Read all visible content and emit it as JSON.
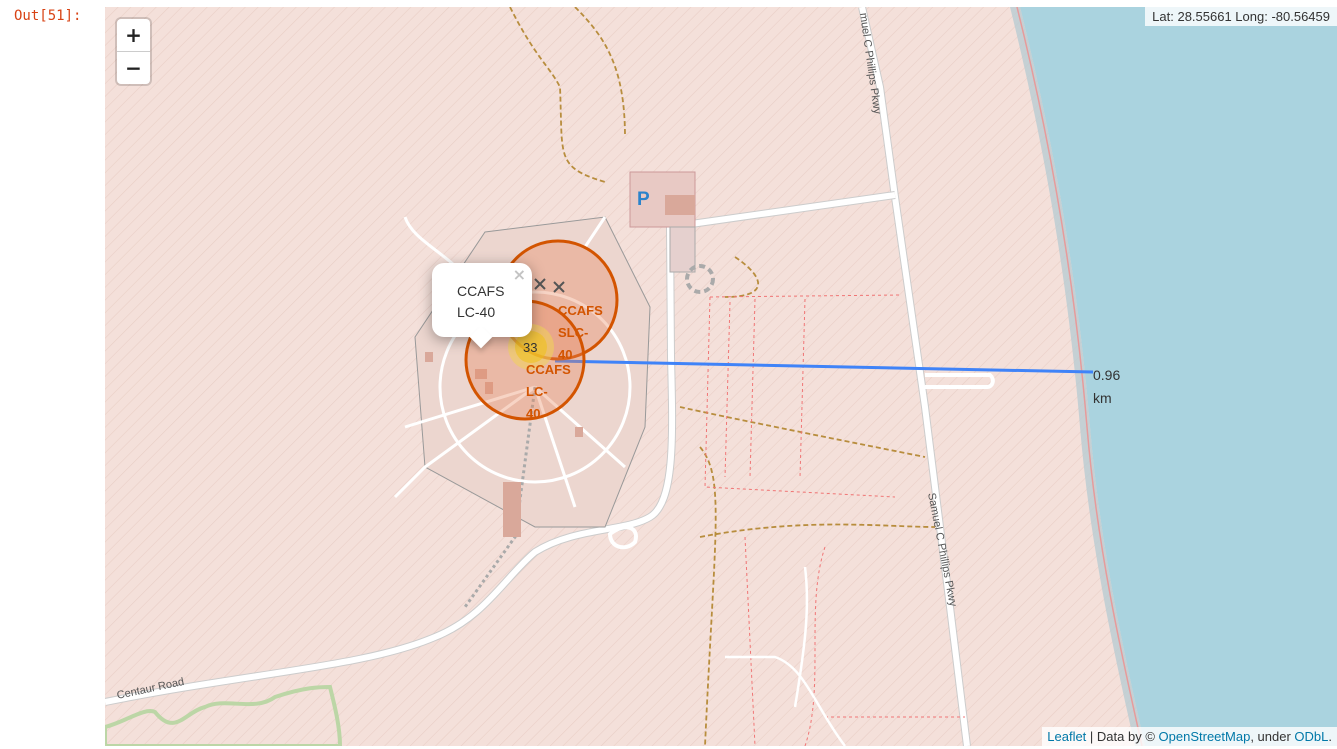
{
  "cell": {
    "out_prompt": "Out[51]:"
  },
  "map": {
    "zoom_in_label": "+",
    "zoom_out_label": "−",
    "coordinate_readout": "Lat: 28.55661 Long: -80.56459",
    "attribution": {
      "leaflet_link": "Leaflet",
      "data_by": " | Data by © ",
      "osm_link": "OpenStreetMap",
      "under": ", under ",
      "license_link": "ODbL",
      "trailing": "."
    },
    "popup": {
      "line1": "CCAFS",
      "line2": "LC-40",
      "close": "×"
    },
    "markers": {
      "cluster_count": "33",
      "slc40": [
        "CCAFS",
        "SLC-",
        "40"
      ],
      "lc40": [
        "CCAFS",
        "LC-",
        "40"
      ]
    },
    "distance_label": {
      "value": "0.96",
      "unit": "km"
    },
    "road_labels": {
      "phillips_top": "muel C Phillips Pkwy",
      "phillips_bottom": "Samuel C Phillips Pkwy",
      "centaur": "Centaur Road"
    },
    "parking_label": "P",
    "colors": {
      "land": "#f4e0da",
      "water": "#aad3df",
      "site_circle": "#d35400",
      "distance_line": "#3f83f8",
      "cluster": "#f1d357"
    }
  }
}
